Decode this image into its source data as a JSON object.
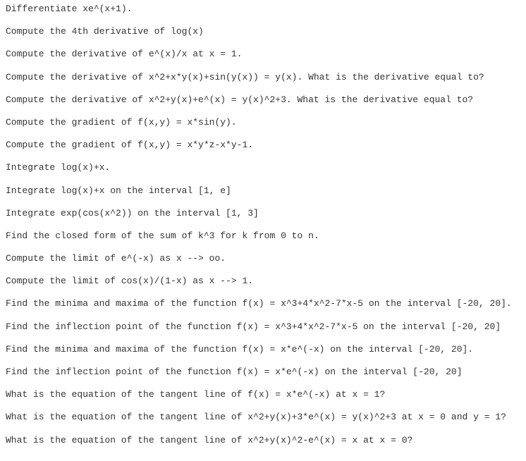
{
  "lines": [
    "Differentiate xe^(x+1).",
    "Compute the 4th derivative of log(x)",
    "Compute the derivative of e^(x)/x at x = 1.",
    "Compute the derivative of x^2+x*y(x)+sin(y(x)) = y(x). What is the derivative equal to?",
    "Compute the derivative of x^2+y(x)+e^(x) = y(x)^2+3. What is the derivative equal to?",
    "Compute the gradient of f(x,y) = x*sin(y).",
    "Compute the gradient of f(x,y) = x*y*z-x*y-1.",
    "Integrate log(x)+x.",
    "Integrate log(x)+x on the interval [1, e]",
    "Integrate exp(cos(x^2)) on the interval [1, 3]",
    "Find the closed form of the sum of k^3 for k from 0 to n.",
    "Compute the limit of e^(-x) as x --> oo.",
    "Compute the limit of cos(x)/(1-x) as x --> 1.",
    "Find the minima and maxima of the function f(x) = x^3+4*x^2-7*x-5 on the interval [-20, 20].",
    "Find the inflection point of the function f(x) = x^3+4*x^2-7*x-5 on the interval [-20, 20]",
    "Find the minima and maxima of the function f(x) = x*e^(-x) on the interval [-20, 20].",
    "Find the inflection point of the function f(x) = x*e^(-x) on the interval [-20, 20]",
    "What is the equation of the tangent line of f(x) = x*e^(-x) at x = 1?",
    "What is the equation of the tangent line of x^2+y(x)+3*e^(x) = y(x)^2+3 at x = 0 and y = 1?",
    "What is the equation of the tangent line of x^2+y(x)^2-e^(x) = x at x = 0?"
  ]
}
